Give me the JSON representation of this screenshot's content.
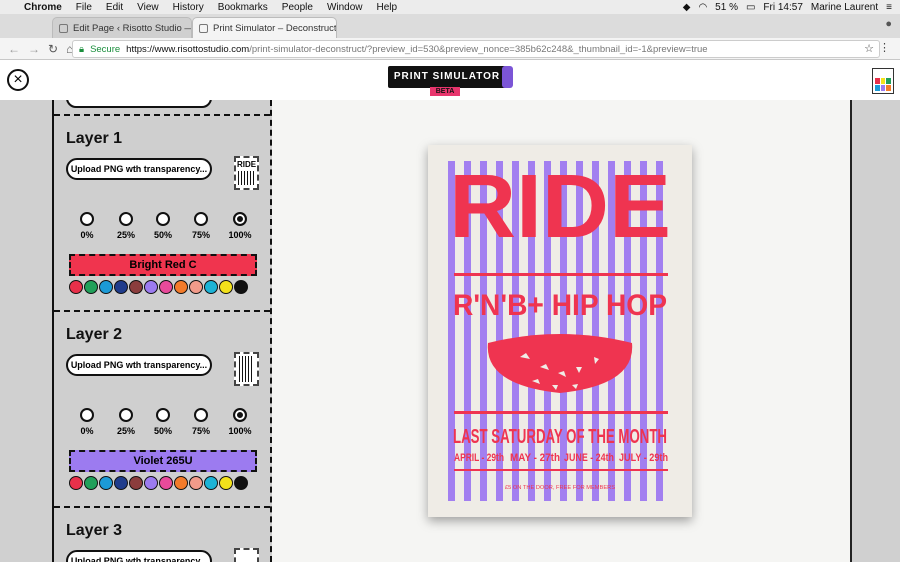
{
  "menubar": {
    "app": "Chrome",
    "items": [
      "File",
      "Edit",
      "View",
      "History",
      "Bookmarks",
      "People",
      "Window",
      "Help"
    ],
    "battery": "51 %",
    "clock": "Fri 14:57",
    "user": "Marine Laurent"
  },
  "tabs": [
    {
      "label": "Edit Page ‹ Risotto Studio — V",
      "active": false
    },
    {
      "label": "Print Simulator – Deconstruct",
      "active": true
    }
  ],
  "address": {
    "secure_label": "Secure",
    "host": "https://www.risottostudio.com",
    "path": "/print-simulator-deconstruct/?preview_id=530&preview_nonce=385b62c248&_thumbnail_id=-1&preview=true"
  },
  "header": {
    "logo_text": "PRINT SIMULATOR",
    "badge": "BETA"
  },
  "layers": [
    {
      "title": "Layer 1",
      "upload_label": "Upload PNG wth transparency...",
      "opacities": [
        "0%",
        "25%",
        "50%",
        "75%",
        "100%"
      ],
      "selected_opacity": "100%",
      "color_name": "Bright Red C",
      "color_hex": "#f0344e"
    },
    {
      "title": "Layer 2",
      "upload_label": "Upload PNG wth transparency...",
      "opacities": [
        "0%",
        "25%",
        "50%",
        "75%",
        "100%"
      ],
      "selected_opacity": "100%",
      "color_name": "Violet 265U",
      "color_hex": "#9c7bf0"
    },
    {
      "title": "Layer 3",
      "upload_label": "Upload PNG wth transparency..."
    }
  ],
  "palette": [
    "#e8304a",
    "#21a05a",
    "#1c9ad6",
    "#1f3c8c",
    "#8b3d3d",
    "#9c7bf0",
    "#e84a9a",
    "#f37b2a",
    "#f29b8a",
    "#1cb3d6",
    "#f3e21b",
    "#111111"
  ],
  "poster": {
    "title": "RIDE",
    "subtitle": "R'N'B+ HIP HOP",
    "headline": "LAST SATURDAY OF THE MONTH",
    "dates": [
      "APRIL - 29th",
      "MAY - 27th",
      "JUNE - 24th",
      "JULY - 29th"
    ],
    "footer": "£5 ON THE DOOR, FREE FOR MEMBERS",
    "ink_red": "#ef3450",
    "ink_violet": "#a27ff0"
  }
}
